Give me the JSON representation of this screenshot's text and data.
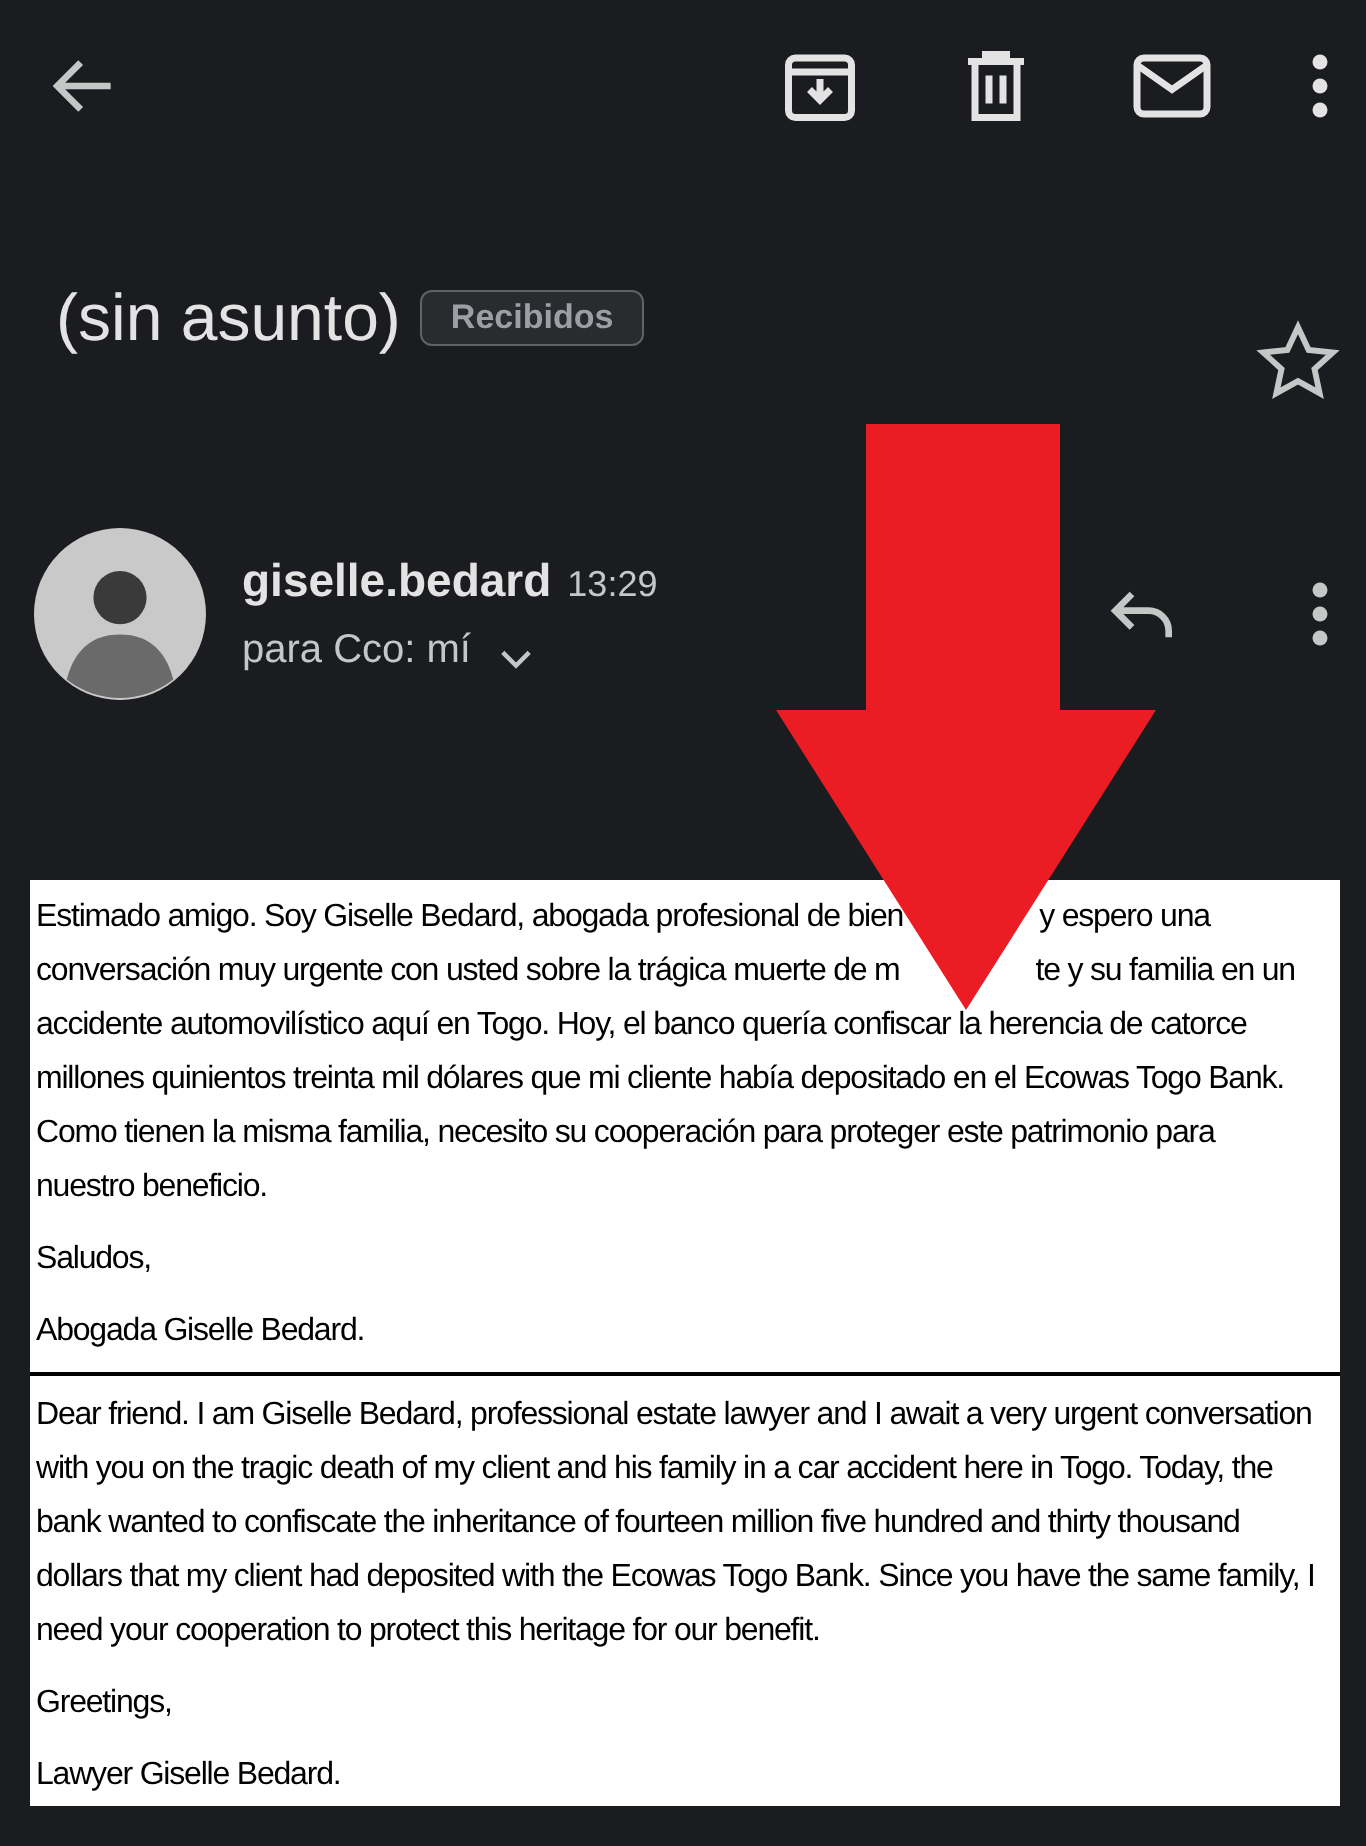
{
  "subject": "(sin asunto)",
  "label": "Recibidos",
  "starred": false,
  "sender": {
    "name": "giselle.bedard",
    "time": "13:29",
    "recipients": "para Cco: mí"
  },
  "body": {
    "sections": [
      {
        "paragraphs": [
          {
            "kind": "lines",
            "lines": [
              [
                "Estimado amigo. Soy Giselle Bedard, abogada profesional de bien",
                "y espero una"
              ],
              [
                "conversación muy urgente con usted sobre la trágica muerte de m",
                "te y su familia en un"
              ],
              [
                "accidente automovilístico aquí en Togo. Hoy, el banco quería confiscar la herencia de catorce"
              ],
              [
                "millones quinientos treinta mil dólares que mi cliente había depositado en el Ecowas Togo Bank."
              ],
              [
                "Como tienen la misma familia, necesito su cooperación para proteger este patrimonio para"
              ],
              [
                "nuestro beneficio."
              ]
            ]
          },
          {
            "kind": "text",
            "text": "Saludos,"
          },
          {
            "kind": "text",
            "text": "Abogada Giselle Bedard."
          }
        ]
      },
      {
        "paragraphs": [
          {
            "kind": "text",
            "text": "Dear friend. I am Giselle Bedard, professional estate lawyer and I await a very urgent conversation with you on the tragic death of my client and his family in a car accident here in Togo. Today, the bank wanted to confiscate the inheritance of fourteen million five hundred and thirty thousand dollars that my client had deposited with the Ecowas Togo Bank. Since you have the same family, I need your cooperation to protect this heritage for our benefit."
          },
          {
            "kind": "text",
            "text": "Greetings,"
          },
          {
            "kind": "text",
            "text": "Lawyer Giselle Bedard."
          }
        ]
      }
    ]
  }
}
